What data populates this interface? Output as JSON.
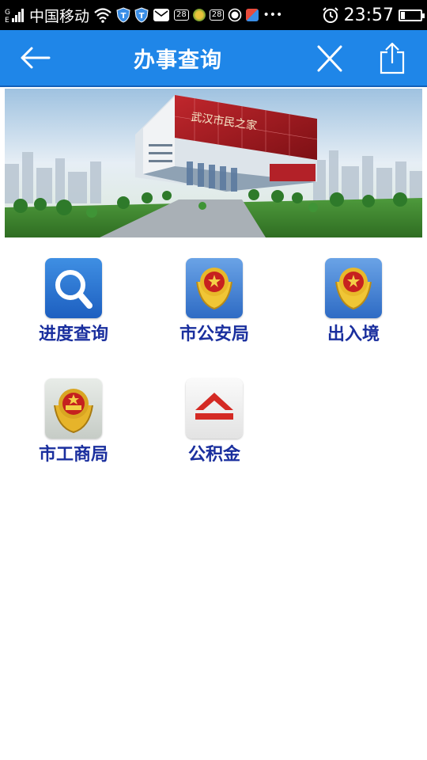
{
  "status_bar": {
    "carrier": "中国移动",
    "badge_1": "28",
    "badge_2": "28",
    "more": "•••",
    "time": "23:57",
    "battery_level": 0.2
  },
  "navbar": {
    "title": "办事查询",
    "back_icon": "arrow-left-icon",
    "close_icon": "close-icon",
    "share_icon": "share-icon"
  },
  "banner": {
    "caption": "武汉市民之家"
  },
  "services": [
    {
      "label": "进度查询",
      "icon": "magnifier-icon"
    },
    {
      "label": "市公安局",
      "icon": "police-emblem-icon"
    },
    {
      "label": "出入境",
      "icon": "police-emblem-icon"
    },
    {
      "label": "市工商局",
      "icon": "national-emblem-icon"
    },
    {
      "label": "公积金",
      "icon": "housing-fund-icon"
    }
  ],
  "colors": {
    "navbar": "#1f86e8",
    "label": "#1a2f9e"
  }
}
